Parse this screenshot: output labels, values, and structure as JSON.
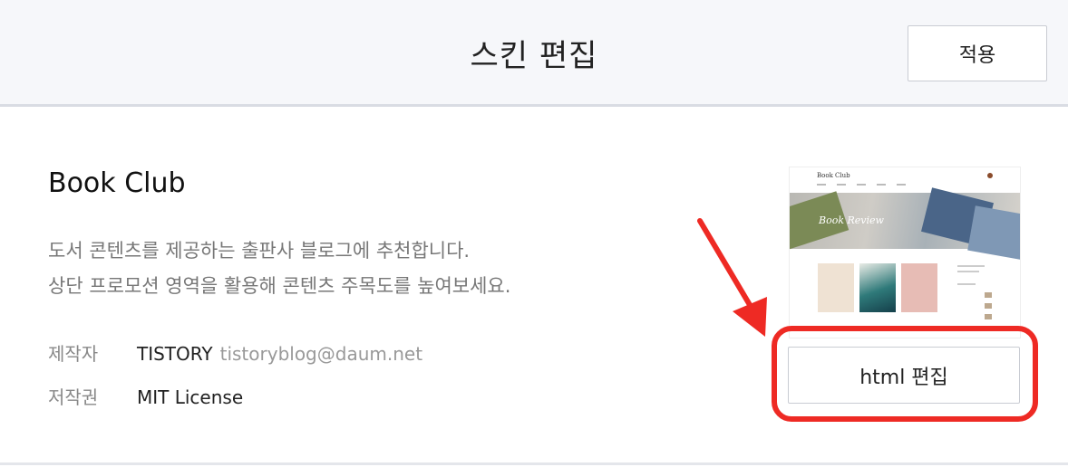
{
  "header": {
    "title": "스킨 편집",
    "apply_label": "적용"
  },
  "skin": {
    "name": "Book Club",
    "description_lines": [
      "도서 콘텐츠를 제공하는 출판사 블로그에 추천합니다.",
      "상단 프로모션 영역을 활용해 콘텐츠 주목도를 높여보세요."
    ],
    "author_label": "제작자",
    "author_name": "TISTORY",
    "author_email": "tistoryblog@daum.net",
    "license_label": "저작권",
    "license_value": "MIT License"
  },
  "thumbnail": {
    "logo_text": "Book Club",
    "banner_text": "Book Review"
  },
  "actions": {
    "html_edit_label": "html 편집"
  },
  "colors": {
    "highlight": "#ee2a24",
    "header_bg": "#f6f7fa"
  },
  "icons": [
    "red-arrow-annotation"
  ]
}
